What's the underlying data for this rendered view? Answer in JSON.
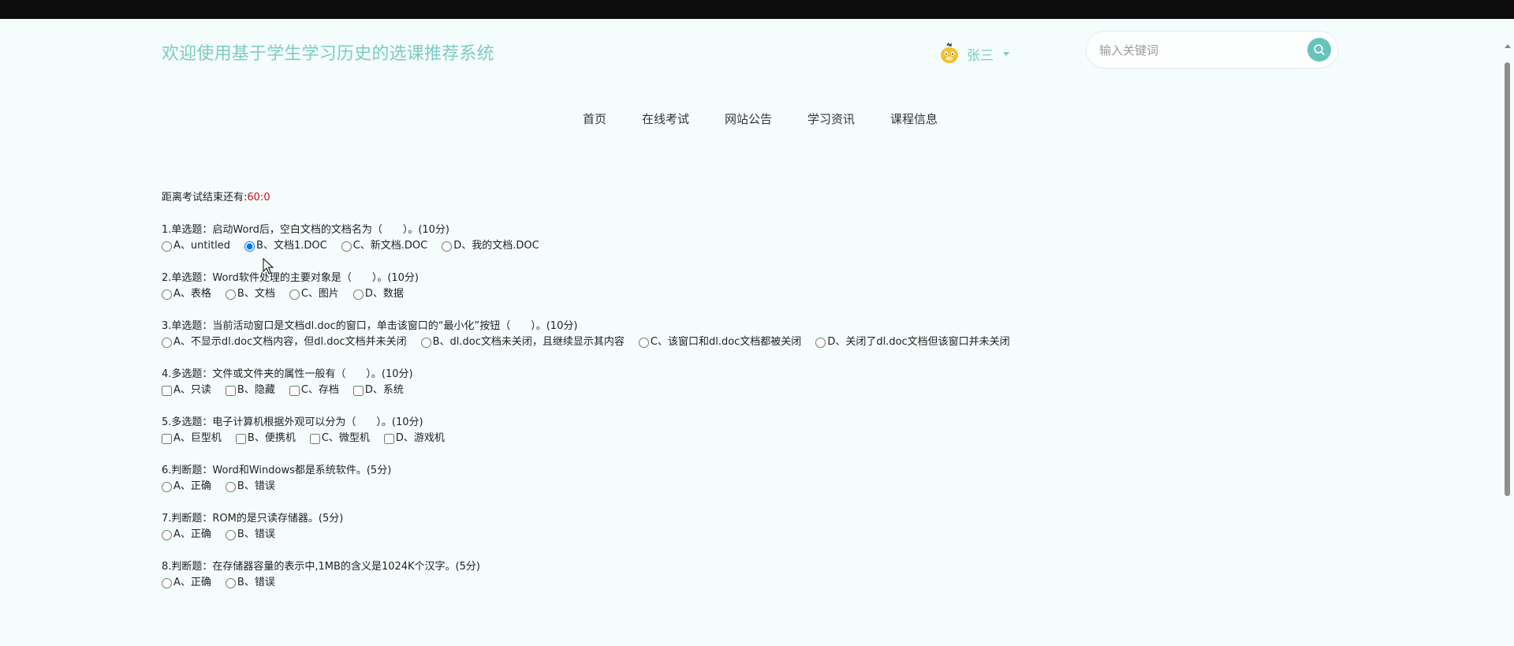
{
  "header": {
    "title": "欢迎使用基于学生学习历史的选课推荐系统",
    "user_name": "张三",
    "search_placeholder": "输入关键词"
  },
  "nav": [
    "首页",
    "在线考试",
    "网站公告",
    "学习资讯",
    "课程信息"
  ],
  "exam": {
    "timer_label": "距离考试结束还有:",
    "timer_value": "60:0",
    "questions": [
      {
        "title": "1.单选题：启动Word后，空白文档的文档名为（　　）。(10分)",
        "input": "radio",
        "options": [
          "A、untitled",
          "B、文档1.DOC",
          "C、新文档.DOC",
          "D、我的文档.DOC"
        ],
        "selected": 1
      },
      {
        "title": "2.单选题：Word软件处理的主要对象是（　　）。(10分)",
        "input": "radio",
        "options": [
          "A、表格",
          "B、文档",
          "C、图片",
          "D、数据"
        ],
        "selected": -1
      },
      {
        "title": "3.单选题：当前活动窗口是文档dl.doc的窗口，单击该窗口的“最小化”按钮（　　）。(10分)",
        "input": "radio",
        "options": [
          "A、不显示dl.doc文档内容，但dl.doc文档并未关闭",
          "B、dl.doc文档未关闭，且继续显示其内容",
          "C、该窗口和dl.doc文档都被关闭",
          "D、关闭了dl.doc文档但该窗口并未关闭"
        ],
        "selected": -1
      },
      {
        "title": "4.多选题：文件或文件夹的属性一般有（　　）。(10分)",
        "input": "checkbox",
        "options": [
          "A、只读",
          "B、隐藏",
          "C、存档",
          "D、系统"
        ],
        "selected": -1
      },
      {
        "title": "5.多选题：电子计算机根据外观可以分为（　　）。(10分)",
        "input": "checkbox",
        "options": [
          "A、巨型机",
          "B、便携机",
          "C、微型机",
          "D、游戏机"
        ],
        "selected": -1
      },
      {
        "title": "6.判断题：Word和Windows都是系统软件。(5分)",
        "input": "radio",
        "options": [
          "A、正确",
          "B、错误"
        ],
        "selected": -1
      },
      {
        "title": "7.判断题：ROM的是只读存储器。(5分)",
        "input": "radio",
        "options": [
          "A、正确",
          "B、错误"
        ],
        "selected": -1
      },
      {
        "title": "8.判断题：在存储器容量的表示中,1MB的含义是1024K个汉字。(5分)",
        "input": "radio",
        "options": [
          "A、正确",
          "B、错误"
        ],
        "selected": -1
      }
    ]
  },
  "icons": {
    "avatar": "duck-avatar-icon",
    "search": "search-icon",
    "caret": "caret-down-icon"
  },
  "colors": {
    "accent": "#7ecbc4",
    "search_button": "#67c4bb",
    "timer": "#c81414",
    "background": "#f4fcfc"
  }
}
